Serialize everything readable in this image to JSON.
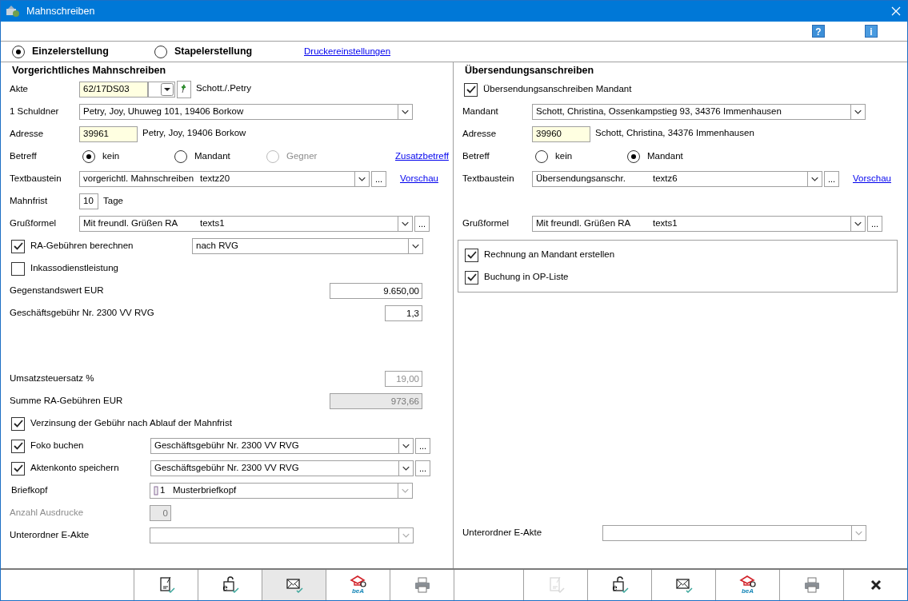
{
  "window": {
    "title": "Mahnschreiben"
  },
  "toolbar": [
    {
      "kind": "help",
      "label": "?"
    },
    {
      "kind": "info",
      "label": "i"
    }
  ],
  "modes": [
    {
      "label": "Einzelerstellung",
      "selected": true
    },
    {
      "label": "Stapelerstellung",
      "selected": false
    }
  ],
  "printer_link": "Druckereinstellungen",
  "left": {
    "title": "Vorgerichtliches Mahnschreiben",
    "rows": [
      {
        "kind": "file",
        "label": "Akte",
        "value": "62/17DS03",
        "note": "Schott./.Petry"
      },
      {
        "kind": "select",
        "label": "1 Schuldner",
        "columns": [
          "Petry, Joy, Uhuweg 101, 19406 Borkow"
        ]
      },
      {
        "kind": "lookup",
        "label": "Adresse",
        "value": "39961",
        "note": "Petry, Joy, 19406 Borkow"
      },
      {
        "kind": "radios",
        "label": "Betreff",
        "options": [
          {
            "label": "kein",
            "selected": true,
            "disabled": false
          },
          {
            "label": "Mandant",
            "selected": false,
            "disabled": false
          },
          {
            "label": "Gegner",
            "selected": false,
            "disabled": true
          }
        ],
        "link": "Zusatzbetreff"
      },
      {
        "kind": "select",
        "label": "Textbaustein",
        "columns": [
          "vorgerichtl. Mahnschreiben",
          "textz20"
        ],
        "more": "...",
        "link": "Vorschau"
      },
      {
        "kind": "period",
        "label": "Mahnfrist",
        "value": "10",
        "unit": "Tage"
      },
      {
        "kind": "select",
        "label": "Grußformel",
        "columns": [
          "Mit freundl. Grüßen RA",
          "texts1"
        ],
        "more": "..."
      },
      {
        "kind": "check",
        "label": "RA-Gebühren berechnen",
        "checked": true,
        "columns": [
          "nach RVG"
        ]
      },
      {
        "kind": "check",
        "label": "Inkassodienstleistung",
        "checked": false
      },
      {
        "kind": "amount",
        "label": "Gegenstandswert  EUR",
        "value": "9.650,00",
        "disabled": false,
        "readonly": false
      },
      {
        "kind": "amount",
        "label": "Geschäftsgebühr Nr. 2300 VV RVG",
        "value": "1,3",
        "disabled": false,
        "readonly": false
      }
    ],
    "fee_rows": [
      {
        "kind": "amount",
        "label": "Umsatzsteuersatz %",
        "value": "19,00",
        "disabled": true,
        "readonly": false
      },
      {
        "kind": "amount",
        "label": "Summe RA-Gebühren EUR",
        "value": "973,66",
        "disabled": false,
        "readonly": true
      },
      {
        "kind": "check",
        "label": "Verzinsung der Gebühr nach Ablauf der Mahnfrist",
        "checked": true
      },
      {
        "kind": "check",
        "label": "Foko buchen",
        "checked": true,
        "columns": [
          "Geschäftsgebühr Nr. 2300 VV RVG"
        ],
        "more": "..."
      },
      {
        "kind": "check",
        "label": "Aktenkonto speichern",
        "checked": true,
        "columns": [
          "Geschäftsgebühr Nr. 2300 VV RVG"
        ],
        "more": "..."
      },
      {
        "kind": "letterhead",
        "label": "Briefkopf",
        "columns": [
          "1",
          "Musterbriefkopf"
        ]
      },
      {
        "kind": "count",
        "label": "Anzahl Ausdrucke",
        "value": "0",
        "disabled": true
      },
      {
        "kind": "folder",
        "label": "Unterordner E-Akte"
      }
    ]
  },
  "right": {
    "title": "Übersendungsanschreiben",
    "rows": [
      {
        "kind": "check",
        "label": "Übersendungsanschreiben Mandant",
        "checked": true
      },
      {
        "kind": "select",
        "label": "Mandant",
        "columns": [
          "Schott, Christina, Ossenkampstieg 93, 34376 Immenhausen"
        ]
      },
      {
        "kind": "lookup",
        "label": "Adresse",
        "value": "39960",
        "note": "Schott, Christina, 34376 Immenhausen"
      },
      {
        "kind": "radios",
        "label": "Betreff",
        "options": [
          {
            "label": "kein",
            "selected": false,
            "disabled": false
          },
          {
            "label": "Mandant",
            "selected": true,
            "disabled": false
          }
        ]
      },
      {
        "kind": "select",
        "label": "Textbaustein",
        "columns": [
          "Übersendungsanschr.",
          "textz6"
        ],
        "more": "...",
        "link": "Vorschau"
      },
      {
        "kind": "select",
        "label": "Grußformel",
        "columns": [
          "Mit freundl. Grüßen RA",
          "texts1"
        ],
        "more": "..."
      }
    ],
    "options": [
      {
        "label": "Rechnung an Mandant erstellen",
        "checked": true
      },
      {
        "label": "Buchung in OP-Liste",
        "checked": true
      }
    ],
    "folder": {
      "label": "Unterordner E-Akte"
    }
  },
  "actions_left": [
    {
      "kind": "note",
      "selected": false,
      "disabled": false
    },
    {
      "kind": "lock",
      "label": "e",
      "selected": false,
      "disabled": false
    },
    {
      "kind": "mail",
      "selected": true,
      "disabled": false
    },
    {
      "kind": "bea",
      "label": "beA",
      "selected": false,
      "disabled": false
    },
    {
      "kind": "print",
      "selected": false,
      "disabled": false
    }
  ],
  "actions_right": [
    {
      "kind": "note",
      "selected": false,
      "disabled": true
    },
    {
      "kind": "lock",
      "label": "e",
      "selected": false,
      "disabled": false
    },
    {
      "kind": "mail",
      "selected": false,
      "disabled": false
    },
    {
      "kind": "bea",
      "label": "beA",
      "selected": false,
      "disabled": false
    },
    {
      "kind": "print",
      "selected": false,
      "disabled": false
    },
    {
      "kind": "close",
      "selected": false,
      "disabled": false
    }
  ]
}
